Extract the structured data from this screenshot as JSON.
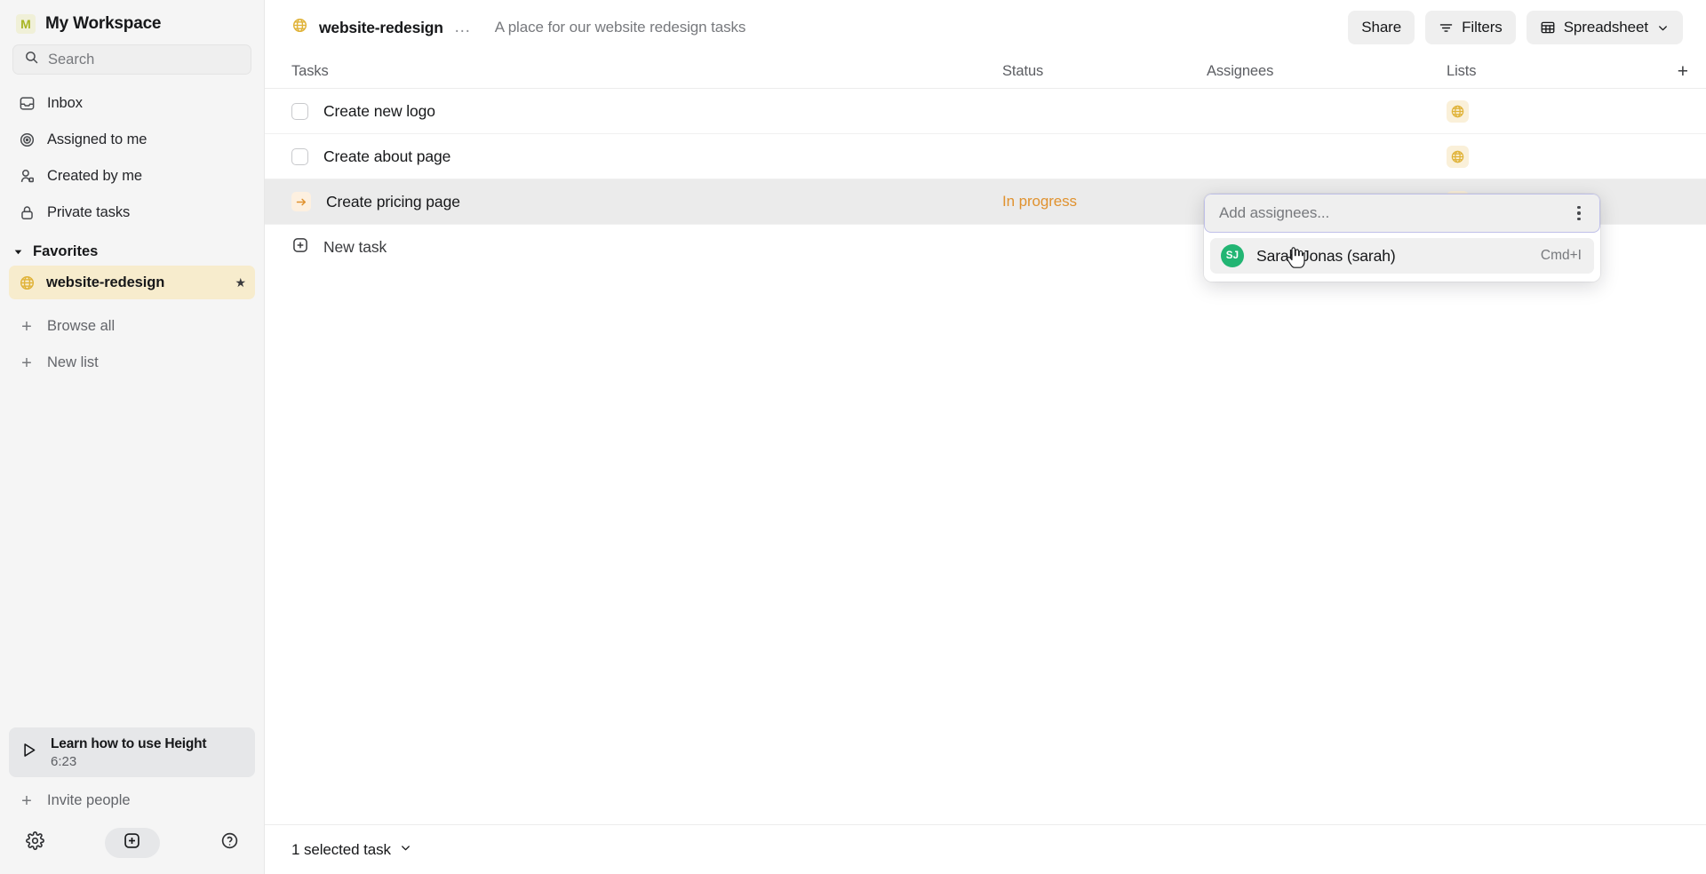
{
  "sidebar": {
    "workspace": {
      "initial": "M",
      "name": "My Workspace"
    },
    "search": {
      "placeholder": "Search"
    },
    "nav_items": [
      {
        "label": "Inbox",
        "icon": "inbox-icon"
      },
      {
        "label": "Assigned to me",
        "icon": "target-icon"
      },
      {
        "label": "Created by me",
        "icon": "user-icon"
      },
      {
        "label": "Private tasks",
        "icon": "lock-icon"
      }
    ],
    "favorites": {
      "label": "Favorites",
      "items": [
        {
          "label": "website-redesign",
          "icon": "globe-icon",
          "starred": "★",
          "active": true
        }
      ]
    },
    "actions": [
      {
        "label": "Browse all",
        "icon": "plus-icon"
      },
      {
        "label": "New list",
        "icon": "plus-icon"
      }
    ],
    "learn_card": {
      "title": "Learn how to use Height",
      "duration": "6:23",
      "icon": "play-icon"
    },
    "invite": {
      "label": "Invite people",
      "icon": "plus-icon"
    },
    "footer": {
      "settings": "gear-icon",
      "new": "plus-square-icon",
      "help": "question-circle-icon"
    }
  },
  "topbar": {
    "list_icon": "globe-icon",
    "list_name": "website-redesign",
    "more": "…",
    "description": "A place for our website redesign tasks",
    "share_label": "Share",
    "filters_label": "Filters",
    "view_label": "Spreadsheet"
  },
  "table": {
    "columns": {
      "tasks": "Tasks",
      "status": "Status",
      "assignees": "Assignees",
      "lists": "Lists",
      "add": "+"
    },
    "rows": [
      {
        "name": "Create new logo",
        "marker": "checkbox",
        "status": "",
        "assignees": "",
        "list_icon": "globe-icon",
        "selected": false
      },
      {
        "name": "Create about page",
        "marker": "checkbox",
        "status": "",
        "assignees": "",
        "list_icon": "globe-icon",
        "selected": false
      },
      {
        "name": "Create pricing page",
        "marker": "in-progress",
        "status": "In progress",
        "assignees": "",
        "list_icon": "globe-icon",
        "selected": true
      }
    ],
    "new_task_label": "New task"
  },
  "popover": {
    "input_placeholder": "Add assignees...",
    "menu_icon": "kebab-icon",
    "options": [
      {
        "initials": "SJ",
        "name": "Sarah Jonas (sarah)",
        "shortcut": "Cmd+I",
        "avatar_color": "#22b573"
      }
    ]
  },
  "statusbar": {
    "selection": "1 selected task",
    "chevron": "chevron-down-icon"
  },
  "colors": {
    "accent_yellow": "#e0b339",
    "status_orange": "#e0922f",
    "favorite_bg": "#f7eccd",
    "avatar_green": "#22b573",
    "popover_border": "#bfc0e8"
  }
}
